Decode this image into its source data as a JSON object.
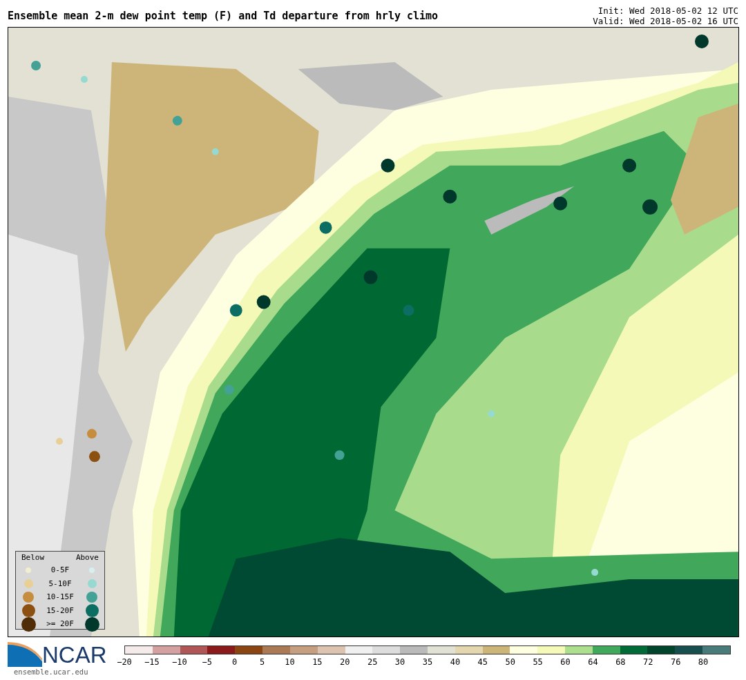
{
  "title": "Ensemble mean 2-m dew point temp (F) and Td departure from hrly climo",
  "init": "Init: Wed 2018-05-02 12 UTC",
  "valid": "Valid: Wed 2018-05-02 16 UTC",
  "legend": {
    "below_label": "Below",
    "above_label": "Above",
    "rows": [
      {
        "label": "0-5F",
        "dots": [
          {
            "color": "#f2eed0"
          },
          {
            "color": "#d8efef"
          }
        ]
      },
      {
        "label": "5-10F",
        "dots": [
          {
            "color": "#e8cf96"
          },
          {
            "color": "#95d9d1"
          }
        ]
      },
      {
        "label": "10-15F",
        "dots": [
          {
            "color": "#c68d3e"
          },
          {
            "color": "#43a195"
          }
        ]
      },
      {
        "label": "15-20F",
        "dots": [
          {
            "color": "#8c5110"
          },
          {
            "color": "#0c6e63"
          }
        ]
      },
      {
        "label": ">= 20F",
        "dots": [
          {
            "color": "#4f2d07"
          },
          {
            "color": "#00382c"
          }
        ]
      }
    ]
  },
  "logo": {
    "text": "NCAR",
    "url": "ensemble.ucar.edu"
  },
  "colorbar": {
    "bins": [
      {
        "color": "#f5ebeb"
      },
      {
        "color": "#d4a0a0"
      },
      {
        "color": "#b05656"
      },
      {
        "color": "#8b1a1a"
      },
      {
        "color": "#8b4513"
      },
      {
        "color": "#ab7a55"
      },
      {
        "color": "#c69e80"
      },
      {
        "color": "#dcc4b0"
      },
      {
        "color": "#f0f0f0"
      },
      {
        "color": "#dddddd"
      },
      {
        "color": "#bababa"
      },
      {
        "color": "#e2e2d4"
      },
      {
        "color": "#e4d6ae"
      },
      {
        "color": "#cdb57a"
      },
      {
        "color": "#fefee0"
      },
      {
        "color": "#f6fab8"
      },
      {
        "color": "#acdf8e"
      },
      {
        "color": "#40a95c"
      },
      {
        "color": "#006b36"
      },
      {
        "color": "#00452c"
      },
      {
        "color": "#174f4f"
      },
      {
        "color": "#4a7b7b"
      }
    ],
    "ticks": [
      "−20",
      "−15",
      "−10",
      "−5",
      "0",
      "5",
      "10",
      "15",
      "20",
      "25",
      "30",
      "35",
      "40",
      "45",
      "50",
      "55",
      "60",
      "64",
      "68",
      "72",
      "76",
      "80"
    ]
  }
}
